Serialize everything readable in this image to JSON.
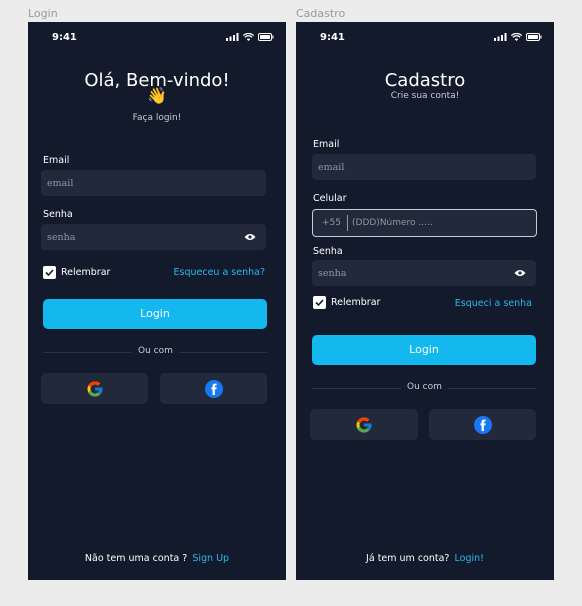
{
  "colors": {
    "screen_bg": "#121a2b",
    "field_bg": "#22293a",
    "accent": "#12b8ee",
    "link": "#2fb6ec"
  },
  "login": {
    "frame_label": "Login",
    "status_time": "9:41",
    "title": "Olá, Bem-vindo!",
    "emoji": "👋",
    "subtitle": "Faça login!",
    "email_label": "Email",
    "email_placeholder": "email",
    "password_label": "Senha",
    "password_placeholder": "senha",
    "remember_label": "Relembrar",
    "forgot_link": "Esqueceu a senha?",
    "login_button": "Login",
    "divider_text": "Ou com",
    "footer_text": "Não tem uma conta ?",
    "footer_link": "Sign Up",
    "social": [
      "google-icon",
      "facebook-icon"
    ]
  },
  "signup": {
    "frame_label": "Cadastro",
    "status_time": "9:41",
    "title": "Cadastro",
    "subtitle": "Crie sua conta!",
    "email_label": "Email",
    "email_placeholder": "email",
    "phone_label": "Celular",
    "phone_prefix": "+55",
    "phone_placeholder": "(DDD)Número .....",
    "password_label": "Senha",
    "password_placeholder": "senha",
    "remember_label": "Relembrar",
    "forgot_link": "Esqueci a senha",
    "login_button": "Login",
    "divider_text": "Ou com",
    "footer_text": "Já tem um conta?",
    "footer_link": "Login!",
    "social": [
      "google-icon",
      "facebook-icon"
    ]
  }
}
